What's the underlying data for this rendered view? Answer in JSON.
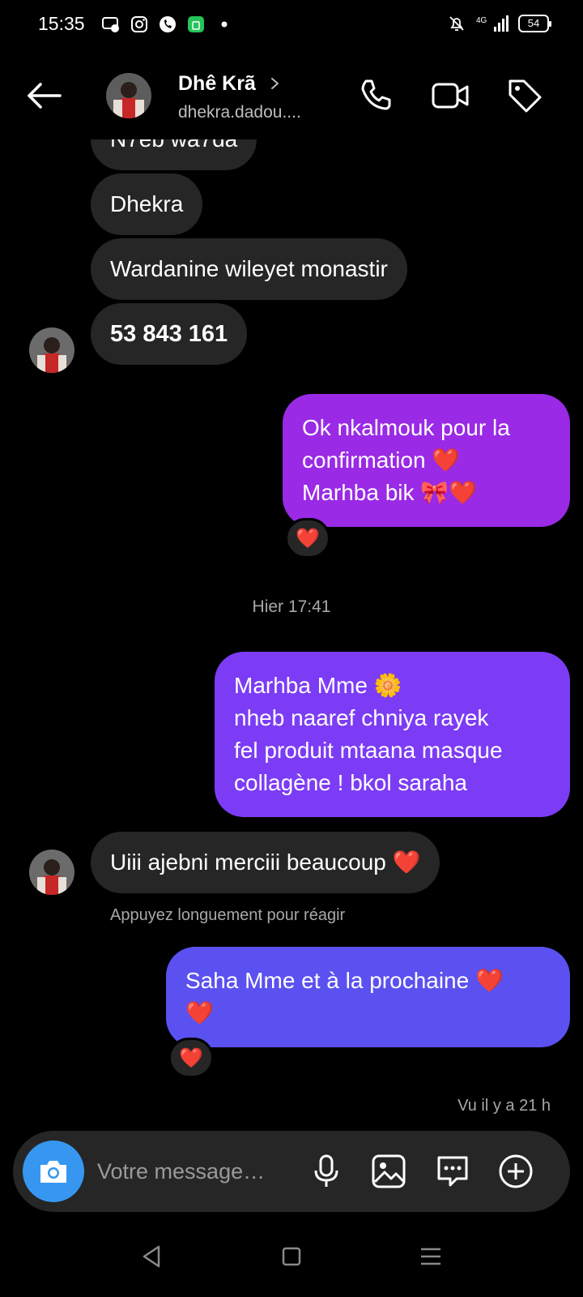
{
  "status_bar": {
    "time": "15:35",
    "network": "4G",
    "battery": "54"
  },
  "header": {
    "name": "Dhê Krã",
    "handle": "dhekra.dadou...."
  },
  "messages": {
    "in_partial": "N7eb wa7da",
    "in_1": "Dhekra",
    "in_2": "Wardanine wileyet monastir",
    "in_3": "53 843 161",
    "out_1_line1": "Ok  nkalmouk pour la",
    "out_1_line2": "confirmation ❤️",
    "out_1_line3": "Marhba bik 🎀❤️",
    "timestamp": "Hier 17:41",
    "out_2_line1": "Marhba Mme 🌼",
    "out_2_line2": "nheb naaref chniya rayek",
    "out_2_line3": "fel produit mtaana masque",
    "out_2_line4": "collagène ! bkol saraha",
    "in_4": "Uiii ajebni merciii beaucoup ❤️",
    "hint": "Appuyez longuement pour réagir",
    "out_3_line1": "Saha Mme et à la prochaine ❤️",
    "out_3_line2": "❤️",
    "reaction": "❤️",
    "seen": "Vu il y a 21 h"
  },
  "composer": {
    "placeholder": "Votre message…"
  },
  "colors": {
    "bubble_in": "#262626",
    "bubble_out_1": "#9a2ae6",
    "bubble_out_2": "#7c3cf5",
    "bubble_out_3": "#5b51f0",
    "camera": "#3797f0"
  },
  "icons": {
    "back": "arrow-left-icon",
    "call": "phone-icon",
    "video": "video-camera-icon",
    "tag": "tag-icon",
    "camera": "camera-icon",
    "mic": "microphone-icon",
    "gallery": "image-icon",
    "sticker": "chat-bubble-icon",
    "plus": "plus-circle-icon"
  }
}
